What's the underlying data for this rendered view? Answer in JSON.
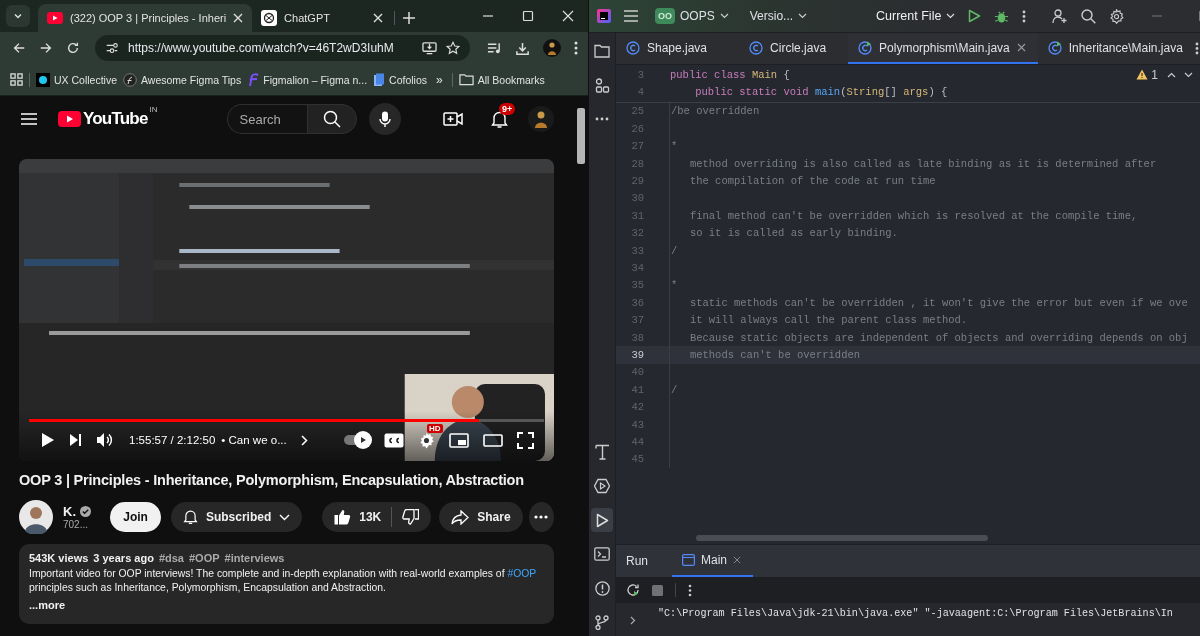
{
  "browser": {
    "tabs": [
      {
        "title": "(322) OOP 3 | Principles - Inheri",
        "kind": "youtube",
        "selected": true
      },
      {
        "title": "ChatGPT",
        "kind": "chatgpt",
        "selected": false
      }
    ],
    "url": "https://www.youtube.com/watch?v=46T2wD3IuhM",
    "bookmarks": [
      {
        "label": "UX Collective",
        "kind": "dot"
      },
      {
        "label": "Awesome Figma Tips",
        "kind": "ring"
      },
      {
        "label": "Figmalion – Figma n...",
        "kind": "squiggle"
      },
      {
        "label": "Cofolios",
        "kind": "document"
      }
    ],
    "overflow": "»",
    "all_bookmarks": "All Bookmarks"
  },
  "youtube": {
    "logo": "YouTube",
    "region": "IN",
    "search": {
      "placeholder": "Search"
    },
    "notifications": "9+",
    "player": {
      "level": 0.873,
      "time": "1:55:57 / 2:12:50",
      "chapter": "• Can we o...",
      "autoplay": true,
      "quality": "HD"
    },
    "title": "OOP 3 | Principles - Inheritance, Polymorphism, Encapsulation, Abstraction",
    "channel": {
      "name": "K.",
      "verified": true,
      "subscribers": "702..."
    },
    "join": "Join",
    "subscribe": "Subscribed",
    "likes": "13K",
    "share": "Share",
    "description": {
      "views": "543K views",
      "age": "3 years ago",
      "tags": [
        "#dsa",
        "#OOP",
        "#interviews"
      ],
      "text": "Important video for OOP interviews! The complete and in-depth explanation with real-world examples of",
      "link": "#OOP",
      "rest": "principles such as Inheritance, Polymorphism, Encapsulation and Abstraction.",
      "more": "...more"
    }
  },
  "ide": {
    "project": {
      "badge": "OO",
      "name": "OOPS"
    },
    "vcs": "Versio...",
    "run_config": "Current File",
    "stripe": [
      {
        "kind": "folder",
        "selected": false
      },
      {
        "kind": "structure",
        "selected": false
      },
      {
        "kind": "more",
        "selected": false
      },
      {
        "kind": "build",
        "selected": false
      },
      {
        "kind": "services",
        "selected": false
      },
      {
        "kind": "run",
        "selected": true
      },
      {
        "kind": "terminal",
        "selected": false
      },
      {
        "kind": "problems",
        "selected": false
      },
      {
        "kind": "git",
        "selected": false
      }
    ],
    "tabs": [
      {
        "label": "Shape.java",
        "kind": "class",
        "selected": false
      },
      {
        "label": "Circle.java",
        "kind": "class",
        "selected": false
      },
      {
        "label": "Polymorphism\\Main.java",
        "kind": "main",
        "selected": true
      },
      {
        "label": "Inheritance\\Main.java",
        "kind": "main",
        "selected": false
      }
    ],
    "sticky_lines": [
      {
        "number": "3",
        "tokens": [
          {
            "text": "public class ",
            "kind": "keyword"
          },
          {
            "text": "Main",
            "kind": "type"
          },
          {
            "text": " {",
            "kind": "plain"
          }
        ]
      },
      {
        "number": "4",
        "tokens": [
          {
            "text": "    public static void ",
            "kind": "keyword"
          },
          {
            "text": "main",
            "kind": "method"
          },
          {
            "text": "(",
            "kind": "plain"
          },
          {
            "text": "String",
            "kind": "type"
          },
          {
            "text": "[] ",
            "kind": "plain"
          },
          {
            "text": "args",
            "kind": "param"
          },
          {
            "text": ") {",
            "kind": "plain"
          }
        ]
      }
    ],
    "warnings": "1",
    "lines": [
      {
        "number": "25",
        "text": "/be overridden",
        "selected": false
      },
      {
        "number": "26",
        "selected": false
      },
      {
        "number": "27",
        "text": "*",
        "selected": false
      },
      {
        "number": "28",
        "text": "   method overriding is also called as late binding as it is determined after",
        "selected": false
      },
      {
        "number": "29",
        "text": "   the compilation of the code at run time",
        "selected": false
      },
      {
        "number": "30",
        "selected": false
      },
      {
        "number": "31",
        "text": "   final method can't be overridden which is resolved at the compile time,",
        "selected": false
      },
      {
        "number": "32",
        "text": "   so it is called as early binding.",
        "selected": false
      },
      {
        "number": "33",
        "text": "/",
        "selected": false
      },
      {
        "number": "34",
        "selected": false
      },
      {
        "number": "35",
        "text": "*",
        "selected": false
      },
      {
        "number": "36",
        "text": "   static methods can't be overridden , it won't give the error but even if we ove",
        "selected": false
      },
      {
        "number": "37",
        "text": "   it will always call the parent class method.",
        "selected": false
      },
      {
        "number": "38",
        "text": "   Because static objects are independent of objects and overriding depends on obj",
        "selected": false
      },
      {
        "number": "39",
        "text": "   methods can't be overridden",
        "selected": true
      },
      {
        "number": "40",
        "selected": false
      },
      {
        "number": "41",
        "text": "/",
        "selected": false
      },
      {
        "number": "42",
        "selected": false
      },
      {
        "number": "43",
        "selected": false
      },
      {
        "number": "44",
        "selected": false
      },
      {
        "number": "45",
        "selected": false
      }
    ],
    "run": {
      "title": "Run",
      "tabs": [
        {
          "label": "Main",
          "selected": true
        }
      ],
      "output": [
        "\"C:\\Program Files\\Java\\jdk-21\\bin\\java.exe\" \"-javaagent:C:\\Program Files\\JetBrains\\In"
      ]
    }
  }
}
